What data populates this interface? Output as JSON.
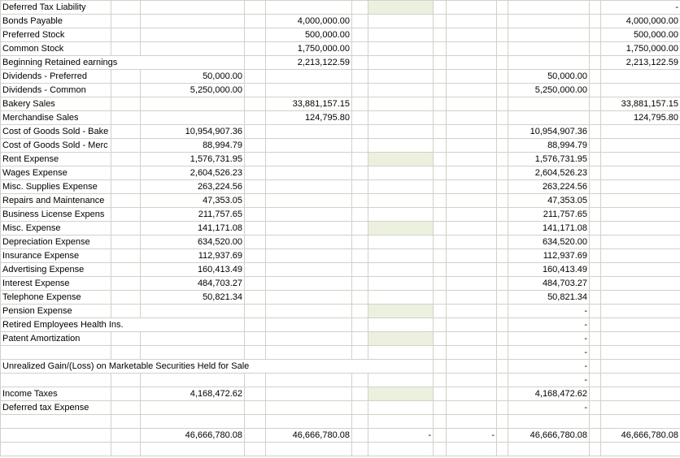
{
  "rows": [
    {
      "label": "Deferred Tax Liability",
      "c2": "",
      "c4": "",
      "c6": "",
      "c8": "",
      "c10": "",
      "c12": "-",
      "hl": [
        6
      ]
    },
    {
      "label": "Bonds Payable",
      "c2": "",
      "c4": "4,000,000.00",
      "c6": "",
      "c8": "",
      "c10": "",
      "c12": "4,000,000.00"
    },
    {
      "label": "Preferred Stock",
      "c2": "",
      "c4": "500,000.00",
      "c6": "",
      "c8": "",
      "c10": "",
      "c12": "500,000.00"
    },
    {
      "label": "Common Stock",
      "c2": "",
      "c4": "1,750,000.00",
      "c6": "",
      "c8": "",
      "c10": "",
      "c12": "1,750,000.00"
    },
    {
      "label": "Beginning Retained earnings",
      "span": 3,
      "c4": "2,213,122.59",
      "c6": "",
      "c8": "",
      "c10": "",
      "c12": "2,213,122.59"
    },
    {
      "label": "Dividends - Preferred",
      "c2": "50,000.00",
      "c4": "",
      "c6": "",
      "c8": "",
      "c10": "50,000.00",
      "c12": ""
    },
    {
      "label": "Dividends - Common",
      "c2": "5,250,000.00",
      "c4": "",
      "c6": "",
      "c8": "",
      "c10": "5,250,000.00",
      "c12": ""
    },
    {
      "label": "Bakery Sales",
      "c2": "",
      "c4": "33,881,157.15",
      "c6": "",
      "c8": "",
      "c10": "",
      "c12": "33,881,157.15"
    },
    {
      "label": "Merchandise Sales",
      "c2": "",
      "c4": "124,795.80",
      "c6": "",
      "c8": "",
      "c10": "",
      "c12": "124,795.80"
    },
    {
      "label": "Cost of Goods Sold - Bake",
      "c2": "10,954,907.36",
      "c4": "",
      "c6": "",
      "c8": "",
      "c10": "10,954,907.36",
      "c12": ""
    },
    {
      "label": "Cost of Goods Sold - Merc",
      "c2": "88,994.79",
      "c4": "",
      "c6": "",
      "c8": "",
      "c10": "88,994.79",
      "c12": ""
    },
    {
      "label": "Rent Expense",
      "c2": "1,576,731.95",
      "c4": "",
      "c6": "",
      "c8": "",
      "c10": "1,576,731.95",
      "c12": "",
      "hl": [
        6
      ]
    },
    {
      "label": "Wages Expense",
      "c2": "2,604,526.23",
      "c4": "",
      "c6": "",
      "c8": "",
      "c10": "2,604,526.23",
      "c12": ""
    },
    {
      "label": "Misc. Supplies Expense",
      "c2": "263,224.56",
      "c4": "",
      "c6": "",
      "c8": "",
      "c10": "263,224.56",
      "c12": ""
    },
    {
      "label": "Repairs and Maintenance",
      "c2": "47,353.05",
      "c4": "",
      "c6": "",
      "c8": "",
      "c10": "47,353.05",
      "c12": ""
    },
    {
      "label": "Business License Expens",
      "c2": "211,757.65",
      "c4": "",
      "c6": "",
      "c8": "",
      "c10": "211,757.65",
      "c12": ""
    },
    {
      "label": "Misc. Expense",
      "c2": "141,171.08",
      "c4": "",
      "c6": "",
      "c8": "",
      "c10": "141,171.08",
      "c12": "",
      "hl": [
        6
      ]
    },
    {
      "label": "Depreciation Expense",
      "c2": "634,520.00",
      "c4": "",
      "c6": "",
      "c8": "",
      "c10": "634,520.00",
      "c12": ""
    },
    {
      "label": "Insurance Expense",
      "c2": "112,937.69",
      "c4": "",
      "c6": "",
      "c8": "",
      "c10": "112,937.69",
      "c12": ""
    },
    {
      "label": "Advertising Expense",
      "c2": "160,413.49",
      "c4": "",
      "c6": "",
      "c8": "",
      "c10": "160,413.49",
      "c12": ""
    },
    {
      "label": "Interest Expense",
      "c2": "484,703.27",
      "c4": "",
      "c6": "",
      "c8": "",
      "c10": "484,703.27",
      "c12": ""
    },
    {
      "label": "Telephone Expense",
      "c2": "50,821.34",
      "c4": "",
      "c6": "",
      "c8": "",
      "c10": "50,821.34",
      "c12": ""
    },
    {
      "label": "Pension Expense",
      "c2": "",
      "c4": "",
      "c6": "",
      "c8": "",
      "c10": "-",
      "c12": "",
      "hl": [
        6
      ]
    },
    {
      "label": "Retired Employees Health Ins.",
      "span": 3,
      "c4": "",
      "c6": "",
      "c8": "",
      "c10": "-",
      "c12": ""
    },
    {
      "label": "Patent Amortization",
      "c2": "",
      "c4": "",
      "c6": "",
      "c8": "",
      "c10": "-",
      "c12": "",
      "hl": [
        6
      ]
    },
    {
      "label": "",
      "c2": "",
      "c4": "",
      "c6": "",
      "c8": "",
      "c10": "-",
      "c12": ""
    },
    {
      "label": "Unrealized Gain/(Loss) on Marketable Securities Held for Sale",
      "span": 7,
      "c8": "",
      "c10": "-",
      "c12": "",
      "hl": [
        6
      ]
    },
    {
      "label": "",
      "c2": "",
      "c4": "",
      "c6": "",
      "c8": "",
      "c10": "-",
      "c12": ""
    },
    {
      "label": "Income Taxes",
      "c2": "4,168,472.62",
      "c4": "",
      "c6": "",
      "c8": "",
      "c10": "4,168,472.62",
      "c12": "",
      "hl": [
        6
      ]
    },
    {
      "label": "Deferred tax Expense",
      "c2": "",
      "c4": "",
      "c6": "",
      "c8": "",
      "c10": "-",
      "c12": ""
    },
    {
      "label": "",
      "c2": "",
      "c4": "",
      "c6": "",
      "c8": "",
      "c10": "",
      "c12": ""
    },
    {
      "label": "",
      "c2": "46,666,780.08",
      "c4": "46,666,780.08",
      "c6": "-",
      "c8": "-",
      "c10": "46,666,780.08",
      "c12": "46,666,780.08"
    },
    {
      "label": "",
      "c2": "",
      "c4": "",
      "c6": "",
      "c8": "",
      "c10": "",
      "c12": ""
    }
  ]
}
